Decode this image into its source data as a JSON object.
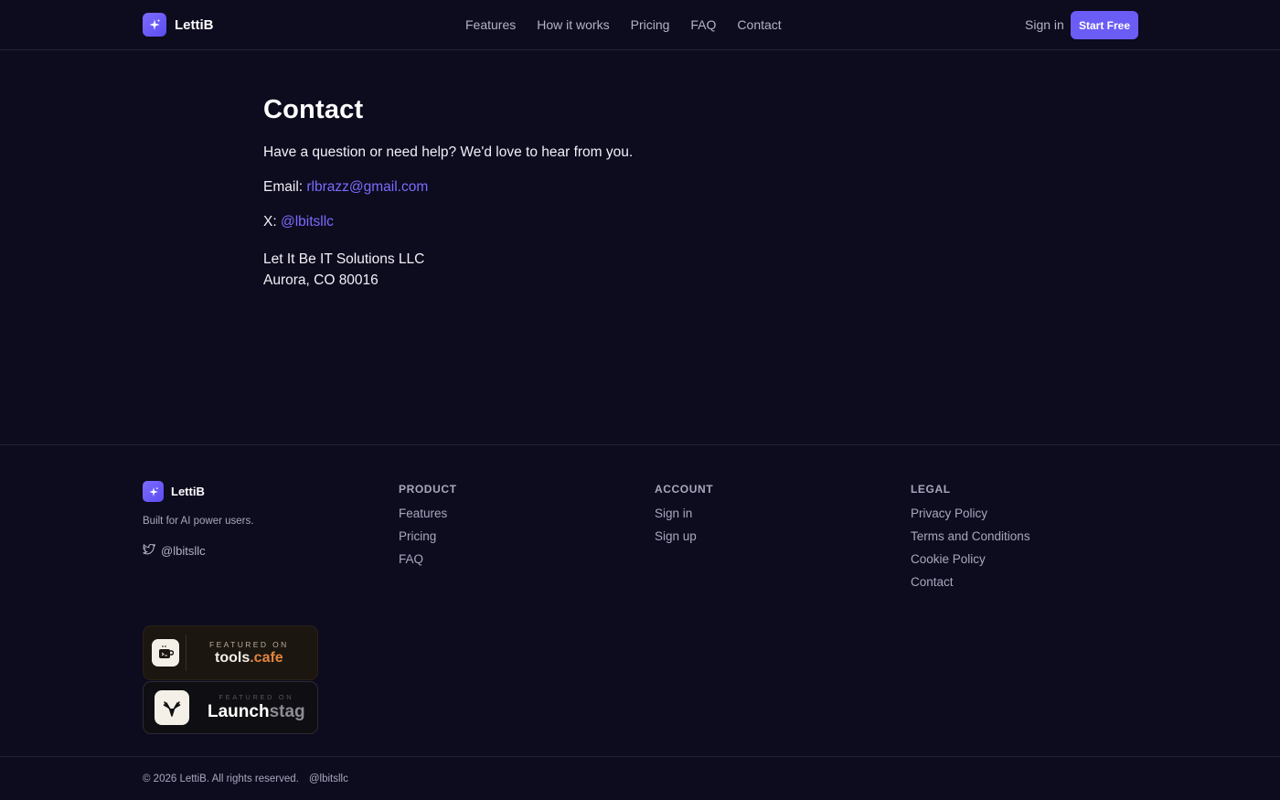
{
  "brand": {
    "name": "LettiB"
  },
  "nav": {
    "items": [
      "Features",
      "How it works",
      "Pricing",
      "FAQ",
      "Contact"
    ],
    "sign_in": "Sign in",
    "start_free": "Start Free"
  },
  "main": {
    "title": "Contact",
    "intro": "Have a question or need help? We'd love to hear from you.",
    "email_label": "Email:",
    "email_value": "rlbrazz@gmail.com",
    "x_label": "X:",
    "x_value": "@lbitsllc",
    "company": "Let It Be IT Solutions LLC",
    "address": "Aurora, CO 80016"
  },
  "footer": {
    "brand_name": "LettiB",
    "tagline": "Built for AI power users.",
    "social_handle": "@lbitsllc",
    "columns": [
      {
        "title": "PRODUCT",
        "links": [
          "Features",
          "Pricing",
          "FAQ"
        ]
      },
      {
        "title": "ACCOUNT",
        "links": [
          "Sign in",
          "Sign up"
        ]
      },
      {
        "title": "LEGAL",
        "links": [
          "Privacy Policy",
          "Terms and Conditions",
          "Cookie Policy",
          "Contact"
        ]
      }
    ],
    "badges": {
      "cafe": {
        "small": "FEATURED ON",
        "big_main": "tools",
        "big_accent": ".cafe"
      },
      "stag": {
        "small": "FEATURED ON",
        "big_main": "Launch",
        "big_muted": "stag"
      }
    },
    "copyright": "© 2026 LettiB. All rights reserved.",
    "copyright_handle": "@lbitsllc"
  },
  "colors": {
    "accent": "#6b5cf6",
    "link": "#7b6cff",
    "background": "#0d0b1e"
  }
}
